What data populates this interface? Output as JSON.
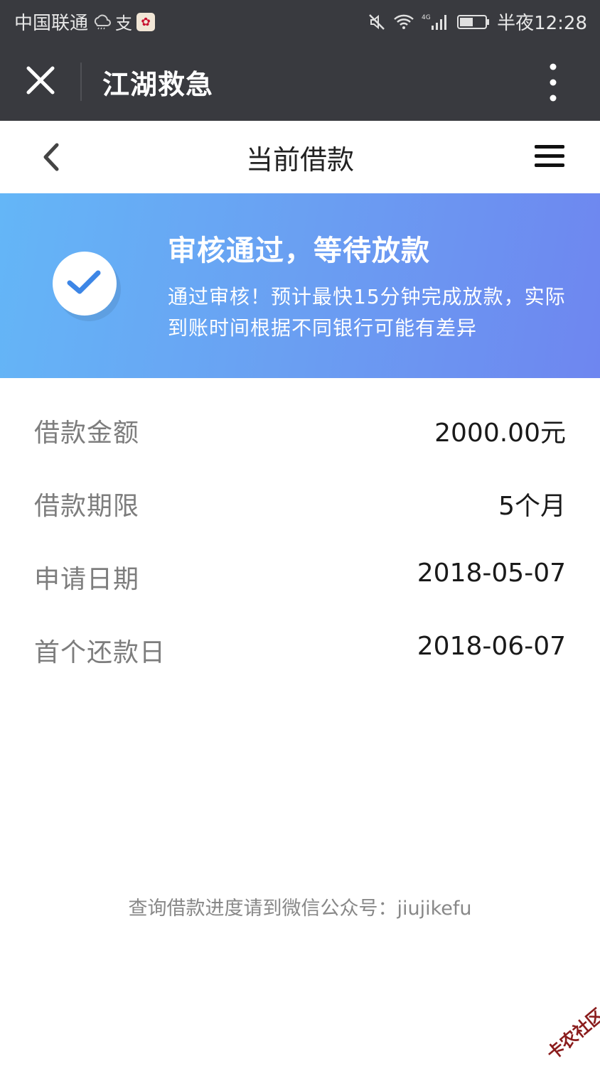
{
  "status_bar": {
    "carrier": "中国联通",
    "time": "半夜12:28",
    "network": "4G",
    "icons": [
      "weather-cloud-icon",
      "alipay-zhi-icon",
      "app-badge-icon",
      "mute-icon",
      "wifi-icon",
      "signal-icon",
      "battery-icon"
    ]
  },
  "wechat_nav": {
    "title": "江湖救急",
    "close_icon": "close-icon",
    "more_icon": "more-vertical-icon"
  },
  "page_header": {
    "title": "当前借款",
    "back_icon": "chevron-left-icon",
    "menu_icon": "hamburger-menu-icon"
  },
  "banner": {
    "status_title": "审核通过，等待放款",
    "status_desc": "通过审核！预计最快15分钟完成放款，实际到账时间根据不同银行可能有差异",
    "icon": "check-circle-icon",
    "gradient_start": "#64b6f7",
    "gradient_end": "#6e86f0"
  },
  "loan_info": [
    {
      "label": "借款金额",
      "value": "2000.00元"
    },
    {
      "label": "借款期限",
      "value": "5个月"
    },
    {
      "label": "申请日期",
      "value": "2018-05-07"
    },
    {
      "label": "首个还款日",
      "value": "2018-06-07"
    }
  ],
  "footer": {
    "note": "查询借款进度请到微信公众号：jiujikefu"
  },
  "watermark": {
    "text": "卡农社区"
  }
}
